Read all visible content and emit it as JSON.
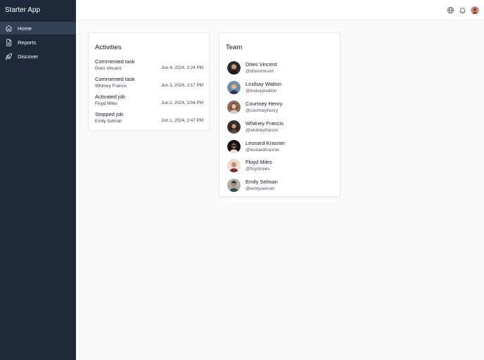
{
  "app": {
    "title": "Starter App"
  },
  "sidebar": {
    "items": [
      {
        "label": "Home",
        "icon": "home-icon",
        "active": true
      },
      {
        "label": "Reports",
        "icon": "document-icon",
        "active": false
      },
      {
        "label": "Discover",
        "icon": "rocket-icon",
        "active": false
      }
    ]
  },
  "header": {
    "icons": [
      "globe-icon",
      "bell-icon",
      "user-avatar"
    ]
  },
  "activities": {
    "title": "Activities",
    "items": [
      {
        "title": "Commented task",
        "user": "Dries Vincent",
        "date": "Jun 4, 2024, 3:24 PM"
      },
      {
        "title": "Commented task",
        "user": "Whitney Francis",
        "date": "Jun 3, 2024, 3:17 PM"
      },
      {
        "title": "Activated job",
        "user": "Floyd Miles",
        "date": "Jun 2, 2024, 3:04 PM"
      },
      {
        "title": "Stopped job",
        "user": "Emily Selman",
        "date": "Jun 1, 2024, 2:47 PM"
      }
    ]
  },
  "team": {
    "title": "Team",
    "members": [
      {
        "name": "Dries Vincent",
        "handle": "@driesvincent"
      },
      {
        "name": "Lindsay Walton",
        "handle": "@lindsaywalton"
      },
      {
        "name": "Courtney Henry",
        "handle": "@courtneyhenry"
      },
      {
        "name": "Whitney Francis",
        "handle": "@whitneyfrancis"
      },
      {
        "name": "Leonard Krasner",
        "handle": "@leonardkrasner"
      },
      {
        "name": "Floyd Miles",
        "handle": "@floydmiles"
      },
      {
        "name": "Emily Selman",
        "handle": "@emilyselman"
      }
    ]
  },
  "colors": {
    "sidebar_bg": "#1e293b",
    "active_nav_bg": "#334155",
    "page_bg": "#f9fafb"
  }
}
